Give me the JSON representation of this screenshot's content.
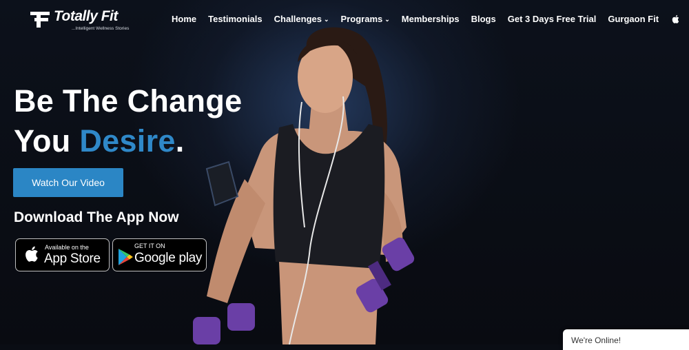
{
  "brand": {
    "name": "Totally Fit",
    "tagline": "...Intelligent Wellness Stories"
  },
  "nav": {
    "items": [
      {
        "label": "Home"
      },
      {
        "label": "Testimonials"
      },
      {
        "label": "Challenges"
      },
      {
        "label": "Programs"
      },
      {
        "label": "Memberships"
      },
      {
        "label": "Blogs"
      },
      {
        "label": "Get 3 Days Free Trial"
      },
      {
        "label": "Gurgaon Fit"
      }
    ],
    "caret": "⌄"
  },
  "hero": {
    "line1": "Be The Change",
    "line2_prefix": "You ",
    "line2_accent": "Desire",
    "line2_suffix": ".",
    "cta_label": "Watch Our Video",
    "download_heading": "Download The App Now"
  },
  "badges": {
    "appstore": {
      "small": "Available on the",
      "big": "App Store"
    },
    "google": {
      "small": "GET IT ON",
      "big": "Google play"
    }
  },
  "chat": {
    "status": "We're Online!"
  },
  "colors": {
    "accent": "#2f88c8",
    "cta": "#2b86c5",
    "dumbbell": "#6a3fa6"
  }
}
